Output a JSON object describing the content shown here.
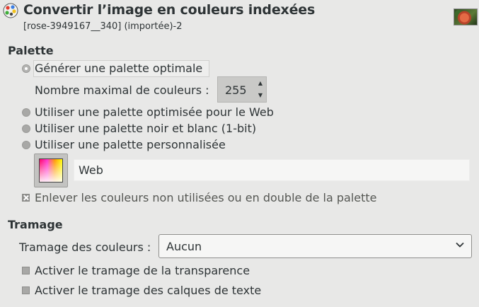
{
  "header": {
    "title": "Convertir l’image en couleurs indexées",
    "subtitle": "[rose-3949167__340] (importée)-2",
    "app_icon": "palette-icon",
    "thumbnail": "rose-thumbnail"
  },
  "palette": {
    "section_label": "Palette",
    "options": [
      {
        "label": "Générer une palette optimale",
        "selected": true
      },
      {
        "label": "Utiliser une palette optimisée pour le Web",
        "selected": false
      },
      {
        "label": "Utiliser une palette noir et blanc (1-bit)",
        "selected": false
      },
      {
        "label": "Utiliser une palette personnalisée",
        "selected": false
      }
    ],
    "max_colors_label": "Nombre maximal de couleurs :",
    "max_colors_value": "255",
    "custom_palette_name": "Web",
    "remove_unused_label": "Enlever les couleurs non utilisées ou en double de la palette",
    "remove_unused_checked": true
  },
  "dithering": {
    "section_label": "Tramage",
    "color_dither_label": "Tramage des couleurs :",
    "color_dither_value": "Aucun",
    "transparency_label": "Activer le tramage de la transparence",
    "transparency_checked": false,
    "text_layers_label": "Activer le tramage des calques de texte",
    "text_layers_checked": false
  }
}
